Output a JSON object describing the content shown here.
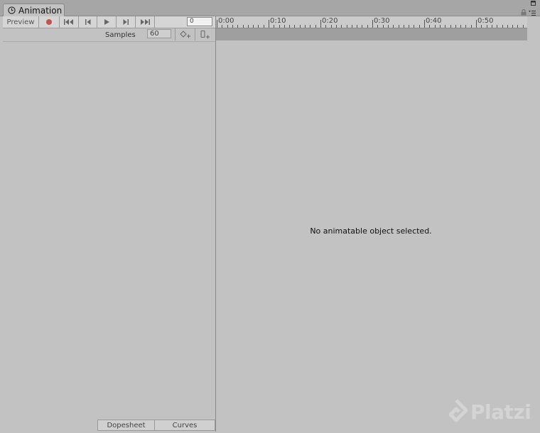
{
  "window": {
    "tab_label": "Animation",
    "tab_icon": "clock-icon",
    "controls": [
      "maximize-icon",
      "lock-icon",
      "context-menu-icon"
    ]
  },
  "toolbar": {
    "preview_label": "Preview",
    "record_color": "#c4534f",
    "buttons": [
      "record-icon",
      "first-keyframe-icon",
      "previous-keyframe-icon",
      "play-icon",
      "next-keyframe-icon",
      "last-keyframe-icon"
    ],
    "frame_value": "0"
  },
  "samples": {
    "label": "Samples",
    "value": "60",
    "add_key_icon": "add-keyframe-icon",
    "add_event_icon": "add-event-icon"
  },
  "timeline": {
    "tick_labels": [
      "0:00",
      "0:10",
      "0:20",
      "0:30",
      "0:40",
      "0:50"
    ]
  },
  "main": {
    "empty_message": "No animatable object selected."
  },
  "bottom_tabs": {
    "dopesheet": "Dopesheet",
    "curves": "Curves"
  },
  "watermark": {
    "brand": "Platzi"
  }
}
